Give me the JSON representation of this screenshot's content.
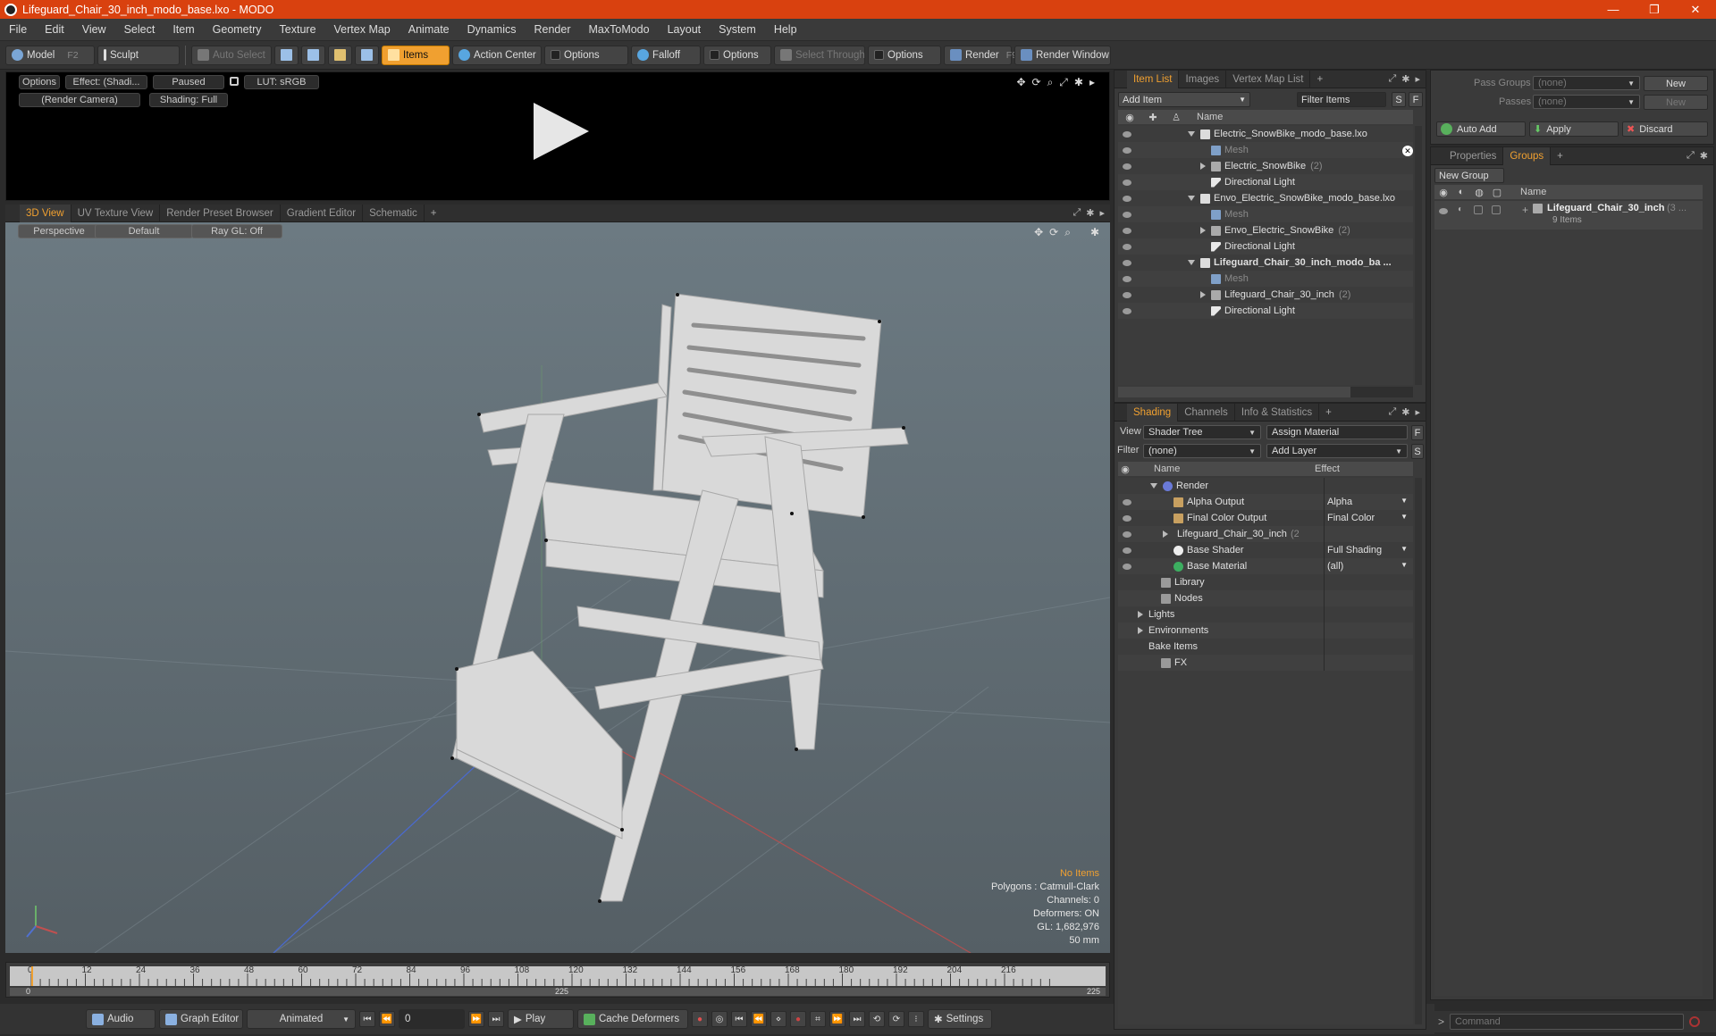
{
  "window": {
    "title": "Lifeguard_Chair_30_inch_modo_base.lxo - MODO",
    "minimize": "—",
    "restore": "❐",
    "close": "✕"
  },
  "menu": [
    "File",
    "Edit",
    "View",
    "Select",
    "Item",
    "Geometry",
    "Texture",
    "Vertex Map",
    "Animate",
    "Dynamics",
    "Render",
    "MaxToModo",
    "Layout",
    "System",
    "Help"
  ],
  "toolbar": {
    "model": "Model",
    "model_key": "F2",
    "sculpt": "Sculpt",
    "auto_select": "Auto Select",
    "items": "Items",
    "action_center": "Action Center",
    "options1": "Options",
    "falloff": "Falloff",
    "options2": "Options",
    "select_through": "Select Through",
    "options3": "Options",
    "render": "Render",
    "render_key": "F9",
    "render_window": "Render Window"
  },
  "preview": {
    "options": "Options",
    "effect": "Effect: (Shadi...",
    "paused": "Paused",
    "lut": "LUT: sRGB",
    "camera": "(Render Camera)",
    "shading": "Shading: Full"
  },
  "viewtabs": [
    "3D View",
    "UV Texture View",
    "Render Preset Browser",
    "Gradient Editor",
    "Schematic",
    "+"
  ],
  "viewport": {
    "perspective": "Perspective",
    "default": "Default",
    "raygl": "Ray GL: Off",
    "hud": {
      "no_items": "No Items",
      "polygons": "Polygons : Catmull-Clark",
      "channels": "Channels: 0",
      "deformers": "Deformers: ON",
      "gl": "GL: 1,682,976",
      "focal": "50 mm"
    }
  },
  "timeline": {
    "ticks": [
      "0",
      "12",
      "24",
      "36",
      "48",
      "60",
      "72",
      "84",
      "96",
      "108",
      "120",
      "132",
      "144",
      "156",
      "168",
      "180",
      "192",
      "204",
      "216"
    ],
    "mini_start": "0",
    "mini_mid": "225",
    "mini_end": "225"
  },
  "bottombar": {
    "audio": "Audio",
    "graph_editor": "Graph Editor",
    "animated": "Animated",
    "frame": "0",
    "play": "Play",
    "cache_deformers": "Cache Deformers",
    "settings": "Settings"
  },
  "itemlist": {
    "tabs": [
      "Item List",
      "Images",
      "Vertex Map List",
      "+"
    ],
    "add_item": "Add Item",
    "filter_items": "Filter Items",
    "s": "S",
    "f": "F",
    "col_name": "Name",
    "rows": [
      {
        "label": "Electric_SnowBike_modo_base.lxo",
        "indent": 1,
        "icon": "scene",
        "exp": "down",
        "bold": false,
        "gray": false,
        "count": ""
      },
      {
        "label": "Mesh",
        "indent": 2,
        "icon": "mesh",
        "exp": "",
        "bold": false,
        "gray": true,
        "count": ""
      },
      {
        "label": "Electric_SnowBike",
        "indent": 2,
        "icon": "grp",
        "exp": "right",
        "bold": false,
        "gray": false,
        "count": "(2)"
      },
      {
        "label": "Directional Light",
        "indent": 2,
        "icon": "light",
        "exp": "",
        "bold": false,
        "gray": false,
        "count": ""
      },
      {
        "label": "Envo_Electric_SnowBike_modo_base.lxo",
        "indent": 1,
        "icon": "scene",
        "exp": "down",
        "bold": false,
        "gray": false,
        "count": ""
      },
      {
        "label": "Mesh",
        "indent": 2,
        "icon": "mesh",
        "exp": "",
        "bold": false,
        "gray": true,
        "count": ""
      },
      {
        "label": "Envo_Electric_SnowBike",
        "indent": 2,
        "icon": "grp",
        "exp": "right",
        "bold": false,
        "gray": false,
        "count": "(2)"
      },
      {
        "label": "Directional Light",
        "indent": 2,
        "icon": "light",
        "exp": "",
        "bold": false,
        "gray": false,
        "count": ""
      },
      {
        "label": "Lifeguard_Chair_30_inch_modo_ba ...",
        "indent": 1,
        "icon": "scene",
        "exp": "down",
        "bold": true,
        "gray": false,
        "count": ""
      },
      {
        "label": "Mesh",
        "indent": 2,
        "icon": "mesh",
        "exp": "",
        "bold": false,
        "gray": true,
        "count": ""
      },
      {
        "label": "Lifeguard_Chair_30_inch",
        "indent": 2,
        "icon": "grp",
        "exp": "right",
        "bold": false,
        "gray": false,
        "count": "(2)"
      },
      {
        "label": "Directional Light",
        "indent": 2,
        "icon": "light",
        "exp": "",
        "bold": false,
        "gray": false,
        "count": ""
      }
    ]
  },
  "shading": {
    "tabs": [
      "Shading",
      "Channels",
      "Info & Statistics",
      "+"
    ],
    "view_label": "View",
    "view_value": "Shader Tree",
    "assign_material": "Assign Material",
    "filter_label": "Filter",
    "filter_value": "(none)",
    "add_layer": "Add Layer",
    "f": "F",
    "s": "S",
    "col_name": "Name",
    "col_effect": "Effect",
    "rows": [
      {
        "label": "Render",
        "indent": 1,
        "icon": "ball",
        "exp": "down",
        "effect": "",
        "eye": false,
        "count": ""
      },
      {
        "label": "Alpha Output",
        "indent": 2,
        "icon": "img",
        "exp": "",
        "effect": "Alpha",
        "eye": true,
        "count": ""
      },
      {
        "label": "Final Color Output",
        "indent": 2,
        "icon": "img",
        "exp": "",
        "effect": "Final Color",
        "eye": true,
        "count": ""
      },
      {
        "label": "Lifeguard_Chair_30_inch",
        "indent": 2,
        "icon": "ballr",
        "exp": "right",
        "effect": "",
        "eye": true,
        "count": "(2 ..."
      },
      {
        "label": "Base Shader",
        "indent": 2,
        "icon": "ballw",
        "exp": "",
        "effect": "Full Shading",
        "eye": true,
        "count": ""
      },
      {
        "label": "Base Material",
        "indent": 2,
        "icon": "ballg",
        "exp": "",
        "effect": "(all)",
        "eye": true,
        "count": ""
      },
      {
        "label": "Library",
        "indent": 1,
        "icon": "folder",
        "exp": "",
        "effect": "",
        "eye": false,
        "count": ""
      },
      {
        "label": "Nodes",
        "indent": 1,
        "icon": "folder",
        "exp": "",
        "effect": "",
        "eye": false,
        "count": ""
      },
      {
        "label": "Lights",
        "indent": 0,
        "icon": "",
        "exp": "right",
        "effect": "",
        "eye": false,
        "count": ""
      },
      {
        "label": "Environments",
        "indent": 0,
        "icon": "",
        "exp": "right",
        "effect": "",
        "eye": false,
        "count": ""
      },
      {
        "label": "Bake Items",
        "indent": 0,
        "icon": "",
        "exp": "",
        "effect": "",
        "eye": false,
        "count": ""
      },
      {
        "label": "FX",
        "indent": 1,
        "icon": "folder",
        "exp": "",
        "effect": "",
        "eye": false,
        "count": ""
      }
    ]
  },
  "passes": {
    "pass_groups_label": "Pass Groups",
    "pass_groups_value": "(none)",
    "passes_label": "Passes",
    "passes_value": "(none)",
    "new1": "New",
    "new2": "New",
    "auto_add": "Auto Add",
    "apply": "Apply",
    "discard": "Discard"
  },
  "groups": {
    "tabs": [
      "Properties",
      "Groups",
      "+"
    ],
    "new_group": "New Group",
    "col_name": "Name",
    "item_name": "Lifeguard_Chair_30_inch",
    "item_count": "(3 ...",
    "item_sub": "9 Items"
  },
  "command": {
    "placeholder": "Command"
  }
}
